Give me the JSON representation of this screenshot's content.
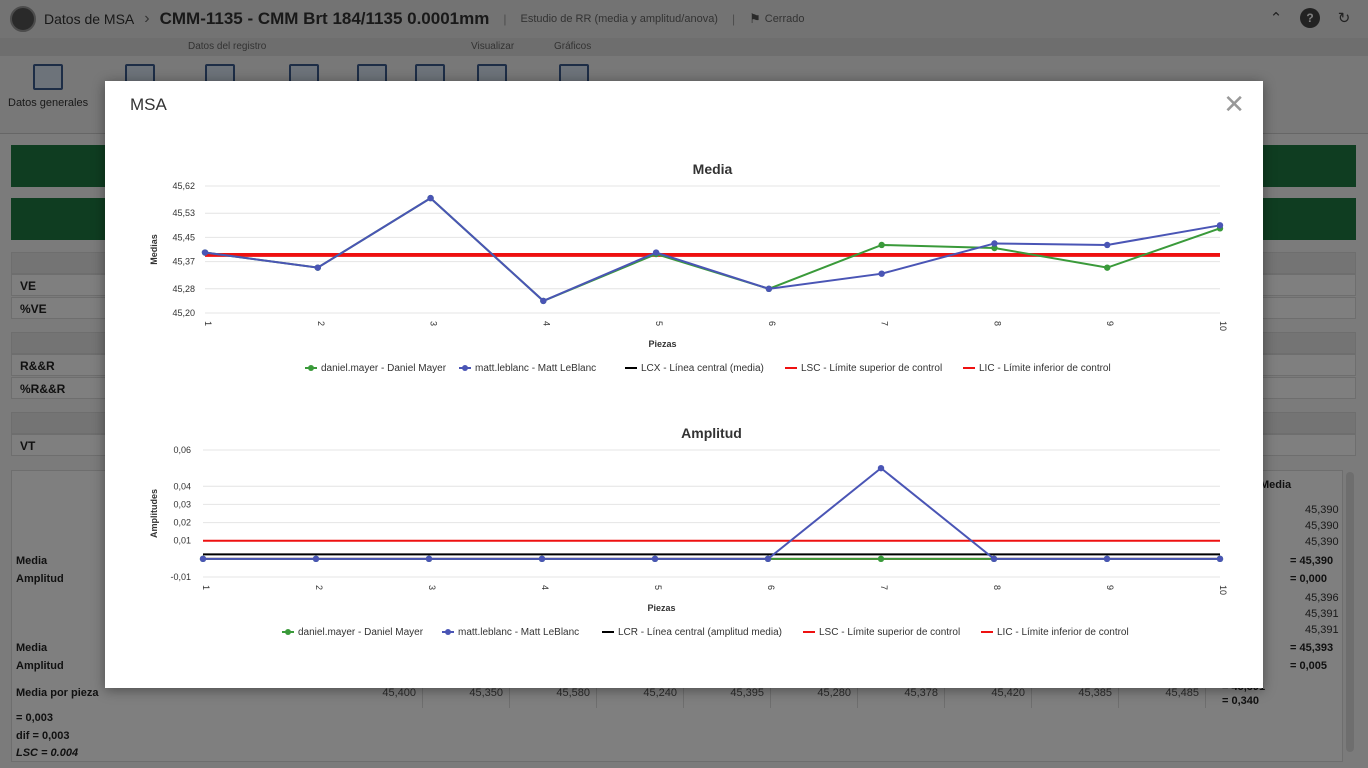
{
  "app": {
    "breadcrumb_parent": "Datos de MSA",
    "title": "CMM-1135 - CMM Brt 184/1135 0.0001mm",
    "study_type": "Estudio de RR (media y amplitud/anova)",
    "status": "Cerrado"
  },
  "ribbon": {
    "groups": [
      "Datos del registro",
      "Visualizar",
      "Gráficos"
    ],
    "first_button_label": "Datos generales"
  },
  "background": {
    "rows": [
      "VE",
      "%VE",
      "R&&R",
      "%R&&R",
      "VT"
    ],
    "col_header_media": "Media",
    "right_values": [
      "45,390",
      "45,390",
      "45,390",
      "45,396",
      "45,391",
      "45,391"
    ],
    "summary_labels": {
      "media": "Media",
      "amplitud": "Amplitud",
      "media_por_pieza": "Media por pieza"
    },
    "summary_values": {
      "xbar1": "= 45,390",
      "r1": "= 0,000",
      "xbar2": "= 45,393",
      "r2": "= 0,005",
      "xbar3": "= 45,391",
      "r3": "= 0,340"
    },
    "media_por_pieza_values": [
      "45,400",
      "45,350",
      "45,580",
      "45,240",
      "45,395",
      "45,280",
      "45,378",
      "45,420",
      "45,385",
      "45,485"
    ],
    "footer": {
      "rbar": "= 0,003",
      "xdif": "dif = 0,003",
      "lsc": "LSC = 0.004"
    }
  },
  "modal": {
    "title": "MSA",
    "close_icon": "close-icon"
  },
  "chart_data": [
    {
      "type": "line",
      "title": "Media",
      "xlabel": "Piezas",
      "ylabel": "Medias",
      "x": [
        "1",
        "2",
        "3",
        "4",
        "5",
        "6",
        "7",
        "8",
        "9",
        "10"
      ],
      "yticks": [
        "45,20",
        "45,28",
        "45,37",
        "45,45",
        "45,53",
        "45,62"
      ],
      "ylim": [
        45.2,
        45.62
      ],
      "series": [
        {
          "name": "daniel.mayer - Daniel Mayer",
          "color": "#3a9a3a",
          "values": [
            45.4,
            45.35,
            45.58,
            45.24,
            45.395,
            45.28,
            45.425,
            45.415,
            45.35,
            45.48
          ]
        },
        {
          "name": "matt.leblanc - Matt LeBlanc",
          "color": "#4a55b5",
          "values": [
            45.4,
            45.35,
            45.58,
            45.24,
            45.4,
            45.28,
            45.33,
            45.43,
            45.425,
            45.49
          ]
        }
      ],
      "control_lines": [
        {
          "name": "LCX - Línea central (media)",
          "color": "#000000",
          "value": 45.392
        },
        {
          "name": "LSC - Límite superior de control",
          "color": "#ee1111",
          "value": 45.395
        },
        {
          "name": "LIC - Límite inferior de control",
          "color": "#ee1111",
          "value": 45.389
        }
      ],
      "grid": true,
      "legend": "bottom"
    },
    {
      "type": "line",
      "title": "Amplitud",
      "xlabel": "Piezas",
      "ylabel": "Amplitudes",
      "x": [
        "1",
        "2",
        "3",
        "4",
        "5",
        "6",
        "7",
        "8",
        "9",
        "10"
      ],
      "yticks": [
        "-0,01",
        "0,01",
        "0,02",
        "0,03",
        "0,04",
        "0,06"
      ],
      "ylim": [
        -0.01,
        0.06
      ],
      "series": [
        {
          "name": "daniel.mayer - Daniel Mayer",
          "color": "#3a9a3a",
          "values": [
            0,
            0,
            0,
            0,
            0,
            0,
            0,
            0,
            0,
            0
          ]
        },
        {
          "name": "matt.leblanc - Matt LeBlanc",
          "color": "#4a55b5",
          "values": [
            0,
            0,
            0,
            0,
            0,
            0,
            0.05,
            0,
            0,
            0
          ]
        }
      ],
      "control_lines": [
        {
          "name": "LCR - Línea central (amplitud media)",
          "color": "#000000",
          "value": 0.0025
        },
        {
          "name": "LSC - Límite superior de control",
          "color": "#ee1111",
          "value": 0.01
        },
        {
          "name": "LIC - Límite inferior de control",
          "color": "#ee1111",
          "value": 0
        }
      ],
      "grid": true,
      "legend": "bottom"
    }
  ]
}
